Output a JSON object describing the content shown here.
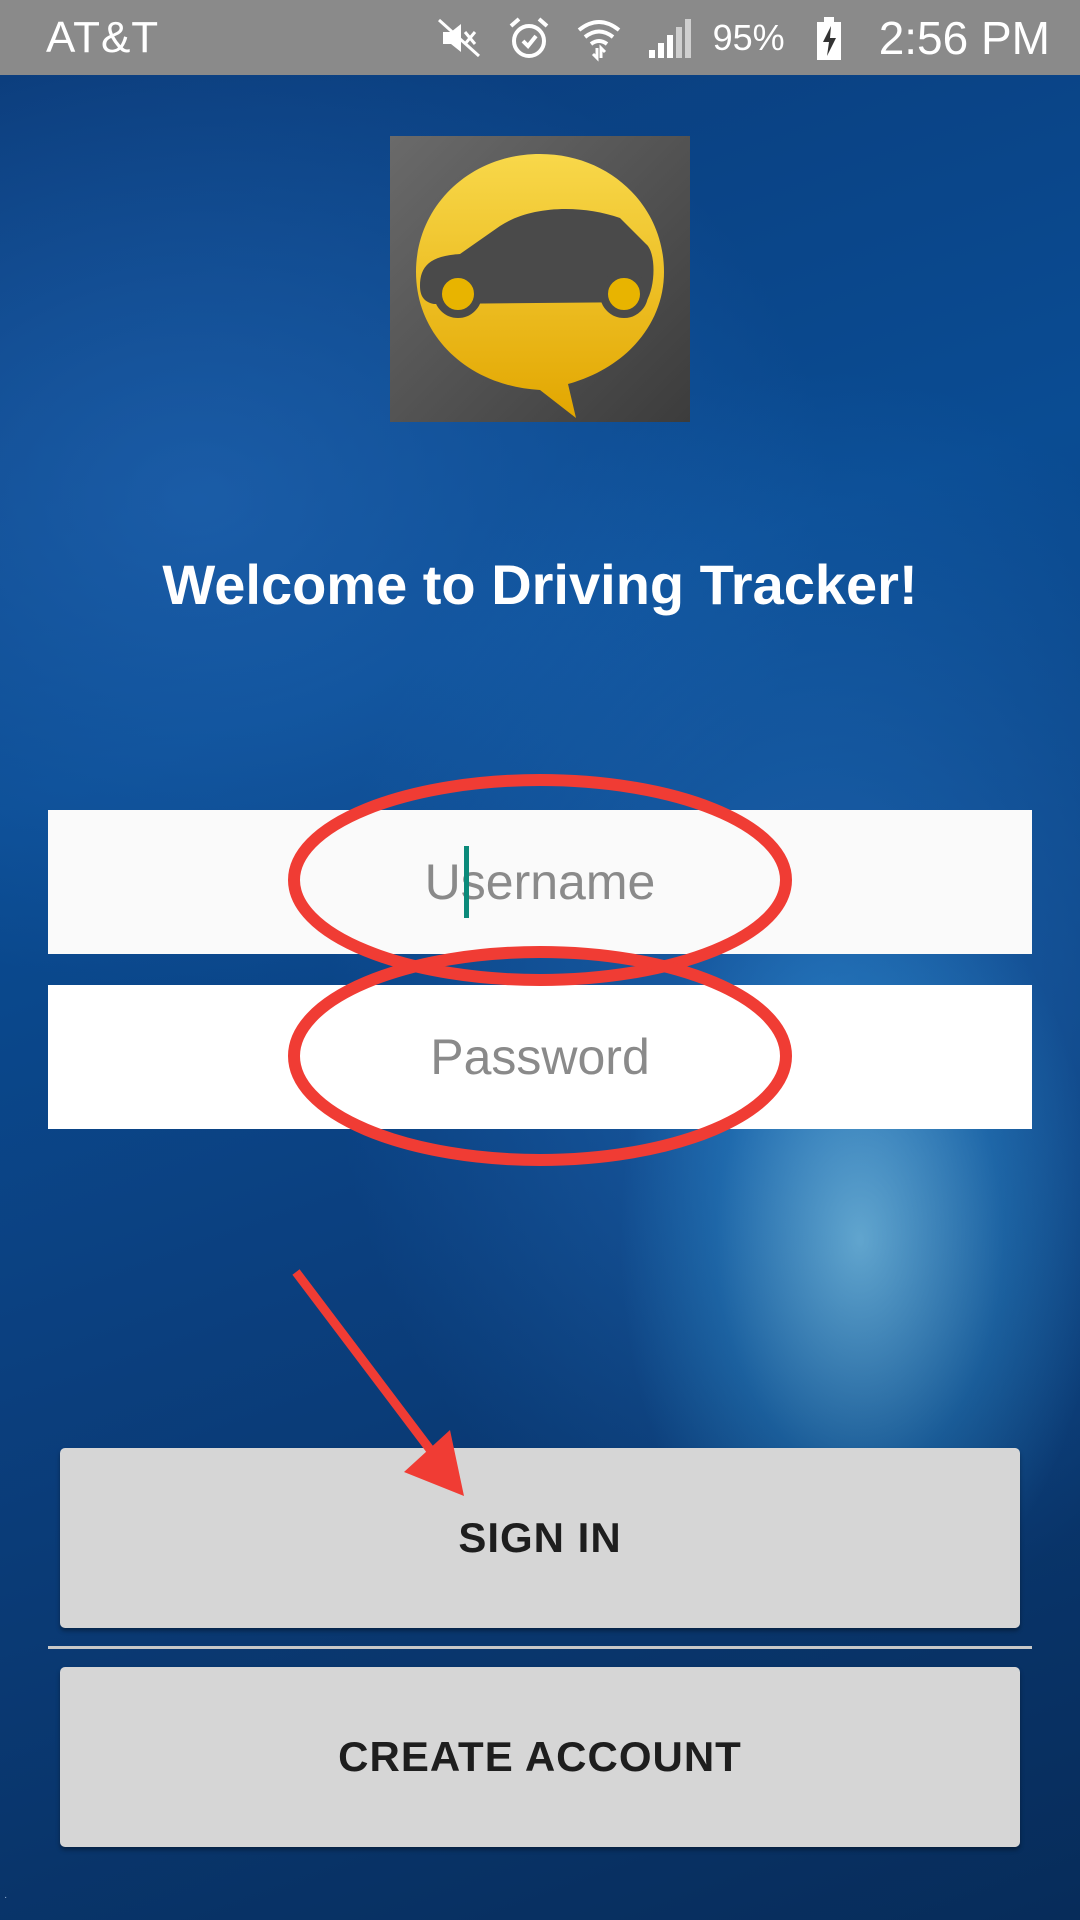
{
  "status_bar": {
    "carrier": "AT&T",
    "battery_percent": "95%",
    "time": "2:56 PM",
    "icons": [
      "mute-icon",
      "alarm-icon",
      "wifi-icon",
      "signal-icon",
      "battery-charging-icon"
    ]
  },
  "app": {
    "logo_icon": "car-chat-bubble-icon",
    "welcome_title": "Welcome to Driving Tracker!"
  },
  "form": {
    "username_placeholder": "Username",
    "password_placeholder": "Password",
    "sign_in_label": "SIGN IN",
    "create_account_label": "CREATE ACCOUNT"
  },
  "colors": {
    "status_bar_bg": "#8a8a8a",
    "logo_yellow": "#f3c21a",
    "button_bg": "#d6d6d6",
    "annotation_red": "#f03c34",
    "cursor_teal": "#0b8a7a"
  }
}
